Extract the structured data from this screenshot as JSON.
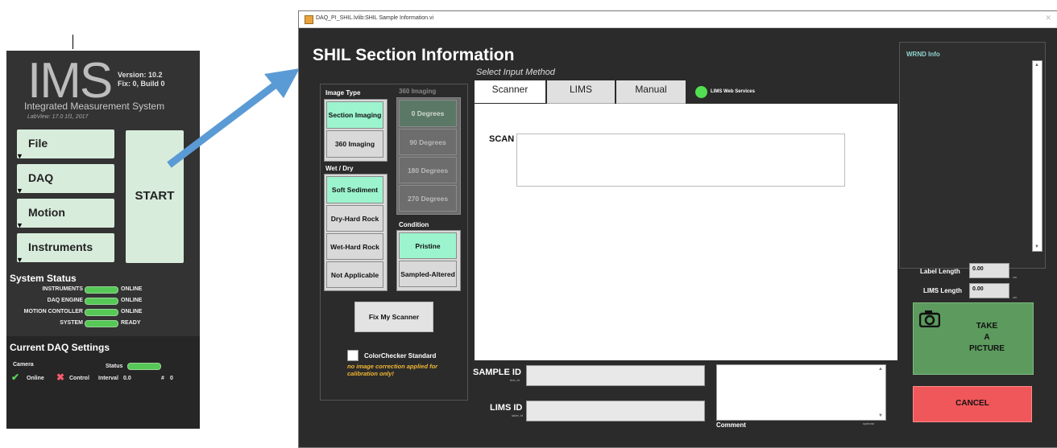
{
  "ims": {
    "logo": "IMS",
    "version": "Version: 10.2",
    "fix": "Fix: 0, Build 0",
    "full_name": "Integrated Measurement System",
    "labview": "LabView: 17.0 1f1, 2017",
    "menu": [
      "File",
      "DAQ",
      "Motion",
      "Instruments"
    ],
    "start_label": "START",
    "system_status_title": "System Status",
    "status_rows": [
      {
        "name": "INSTRUMENTS",
        "value": "ONLINE"
      },
      {
        "name": "DAQ ENGINE",
        "value": "ONLINE"
      },
      {
        "name": "MOTION CONTOLLER",
        "value": "ONLINE"
      },
      {
        "name": "SYSTEM",
        "value": "READY"
      }
    ],
    "daq_title": "Current DAQ Settings",
    "camera_label": "Camera",
    "status_label": "Status",
    "online_label": "Online",
    "control_label": "Control",
    "interval_label": "Interval",
    "interval_value": "0.0",
    "count_label": "#",
    "count_value": "0"
  },
  "window": {
    "titlebar": "DAQ_PI_SHIL.lvlib:SHIL Sample Information.vi",
    "title": "SHIL Section Information",
    "select_input": "Select Input Method",
    "image_type_label": "Image Type",
    "image_type_options": [
      "Section Imaging",
      "360 Imaging"
    ],
    "imaging360_label": "360 Imaging",
    "imaging360_options": [
      "0 Degrees",
      "90 Degrees",
      "180 Degrees",
      "270 Degrees"
    ],
    "wetdry_label": "Wet / Dry",
    "wetdry_options": [
      "Soft Sediment",
      "Dry-Hard Rock",
      "Wet-Hard Rock",
      "Not Applicable"
    ],
    "condition_label": "Condition",
    "condition_options": [
      "Pristine",
      "Sampled-Altered"
    ],
    "fix_scanner": "Fix My Scanner",
    "colorchecker": "ColorChecker Standard",
    "warning": "no image correction applied for calibration only!",
    "tabs": [
      "Scanner",
      "LIMS",
      "Manual"
    ],
    "lims_ws": "LIMS Web Services",
    "scan_label": "SCAN",
    "sample_id_label": "SAMPLE ID",
    "sample_id_sub": "text_id",
    "lims_id_label": "LIMS ID",
    "lims_id_sub": "label_id",
    "comment_label": "Comment",
    "optional": "optional",
    "wrnd_label": "WRND Info",
    "label_length": "Label Length",
    "label_length_value": "0.00",
    "lims_length": "LIMS Length",
    "lims_length_value": "0.00",
    "unit": "cm",
    "take_picture": [
      "TAKE",
      "A",
      "PICTURE"
    ],
    "cancel": "CANCEL"
  },
  "colors": {
    "selected_green": "#9cf4cf",
    "take_picture_bg": "#5c9a5e",
    "cancel_bg": "#f0575a",
    "arrow": "#5b9bd5",
    "status_led": "#55c855"
  }
}
